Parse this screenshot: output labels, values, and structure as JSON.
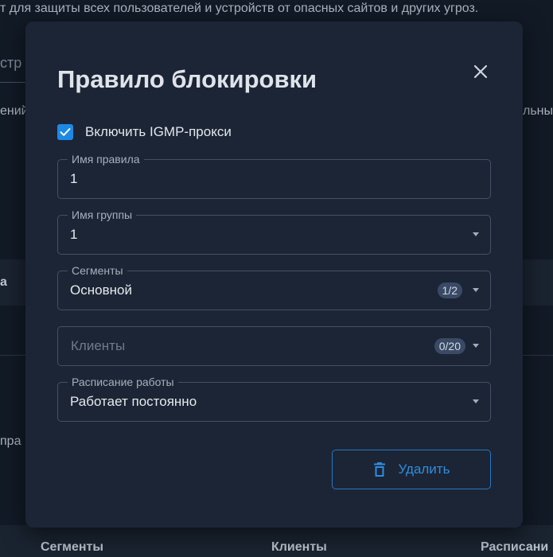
{
  "background": {
    "intro_text": "т для защиты всех пользователей и устройств от опасных сайтов и других угроз.",
    "tab_fragment": "стр",
    "left_fragment_1": "ений",
    "right_fragment_1": "льны",
    "header_fragment": "а",
    "left_fragment_2": "пра",
    "table_headers": [
      "Сегменты",
      "Клиенты",
      "Расписани"
    ]
  },
  "dialog": {
    "title": "Правило блокировки",
    "close_icon": "close-icon",
    "checkbox": {
      "label": "Включить IGMP-прокси",
      "checked": true
    },
    "fields": {
      "rule_name": {
        "legend": "Имя правила",
        "value": "1"
      },
      "group_name": {
        "legend": "Имя группы",
        "value": "1"
      },
      "segments": {
        "legend": "Сегменты",
        "value": "Основной",
        "badge": "1/2"
      },
      "clients": {
        "placeholder": "Клиенты",
        "badge": "0/20"
      },
      "schedule": {
        "legend": "Расписание работы",
        "value": "Работает постоянно"
      }
    },
    "delete_button": {
      "label": "Удалить",
      "icon": "trash-icon"
    }
  },
  "colors": {
    "accent": "#1e88e5",
    "dialog_bg": "#1c2535",
    "page_bg": "#121a26"
  }
}
